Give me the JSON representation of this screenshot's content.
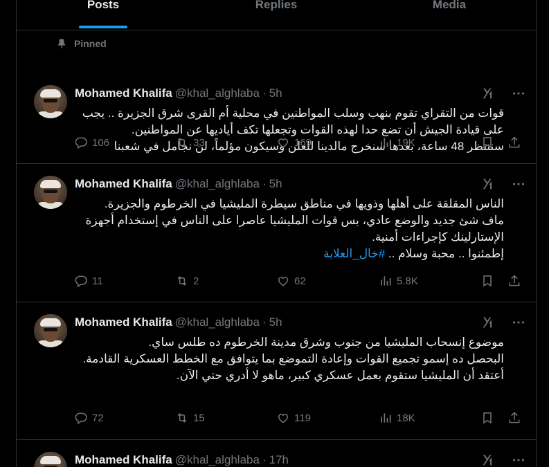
{
  "tabs": [
    {
      "label": "Posts",
      "active": true
    },
    {
      "label": "Replies",
      "active": false
    },
    {
      "label": "Media",
      "active": false
    }
  ],
  "pinned_label": "Pinned",
  "posts": [
    {
      "name": "Mohamed Khalifa",
      "handle": "@khal_alghlaba",
      "dot": "·",
      "time": "5h",
      "lines": [
        "قوات من التقراي تقوم بنهب وسلب المواطنين في محلية أم القرى شرق الجزيرة .. يجب على قيادة الجيش أن تضع حدا لهذه القوات وتجعلها تكف أياديها عن المواطنين.",
        "سننتظر 48 ساعة، بعدها سنخرج مالدينا للعلن وسيكون مؤلماً، لن نجامل في شعبنا"
      ],
      "replies": "106",
      "reposts": "33",
      "likes": "169",
      "views": "19K"
    },
    {
      "name": "Mohamed Khalifa",
      "handle": "@khal_alghlaba",
      "dot": "·",
      "time": "5h",
      "lines": [
        "الناس المقلقة على أهلها وذويها في مناطق سيطرة المليشيا في الخرطوم والجزيرة.",
        "ماف شئ جديد والوضع عادي، بس قوات المليشيا عاصرا على الناس في إستخدام أجهزة الإستارلينك كإجراءات أمنية.",
        "إطمئنوا .. محبة وسلام .."
      ],
      "hashtag": "#خال_العلابة",
      "replies": "11",
      "reposts": "2",
      "likes": "62",
      "views": "5.8K"
    },
    {
      "name": "Mohamed Khalifa",
      "handle": "@khal_alghlaba",
      "dot": "·",
      "time": "5h",
      "lines": [
        "موضوع إنسحاب المليشيا من جنوب وشرق مدينة الخرطوم ده طلس ساي.",
        "البحصل ده إسمو تجميع القوات وإعادة التموضع بما يتوافق مع الخطط العسكرية القادمة.",
        "أعتقد أن المليشيا ستقوم بعمل عسكري كبير، ماهو لا أدري حتي الآن."
      ],
      "replies": "72",
      "reposts": "15",
      "likes": "119",
      "views": "18K"
    },
    {
      "name": "Mohamed Khalifa",
      "handle": "@khal_alghlaba",
      "dot": "·",
      "time": "17h"
    }
  ],
  "icons": {
    "pin": "pin-icon",
    "grok": "grok-icon",
    "more": "more-icon",
    "reply": "reply-icon",
    "repost": "repost-icon",
    "like": "like-icon",
    "views": "views-icon",
    "bookmark": "bookmark-icon",
    "share": "share-icon"
  },
  "colors": {
    "background": "#000000",
    "accent": "#1d9bf0",
    "text": "#e7e9ea",
    "muted": "#71767b",
    "border": "#2f3336"
  }
}
